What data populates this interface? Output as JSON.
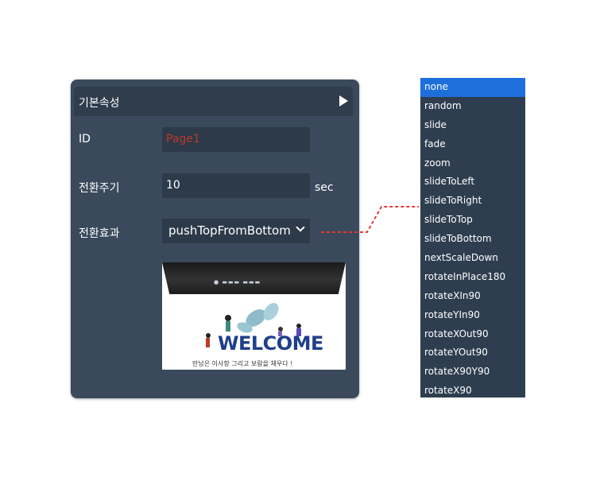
{
  "panel": {
    "title": "기본속성",
    "fields": {
      "id_label": "ID",
      "id_value": "Page1",
      "interval_label": "전환주기",
      "interval_value": "10",
      "interval_unit": "sec",
      "effect_label": "전환효과",
      "effect_value": "pushTopFromBottom"
    },
    "preview": {
      "headline": "WELCOME",
      "caption": "만남은 이사항 그리고 보람을 채우다 !"
    }
  },
  "dropdown": {
    "selected": "none",
    "options": [
      "none",
      "random",
      "slide",
      "fade",
      "zoom",
      "slideToLeft",
      "slideToRight",
      "slideToTop",
      "slideToBottom",
      "nextScaleDown",
      "rotateInPlace180",
      "rotateXIn90",
      "rotateYIn90",
      "rotateXOut90",
      "rotateYOut90",
      "rotateX90Y90",
      "rotateX90"
    ]
  },
  "colors": {
    "panel_bg": "#3a4a5c",
    "field_bg": "#2c3a49",
    "id_text": "#c0392b",
    "selected_option": "#1e6fdc",
    "connector": "#e53935"
  }
}
